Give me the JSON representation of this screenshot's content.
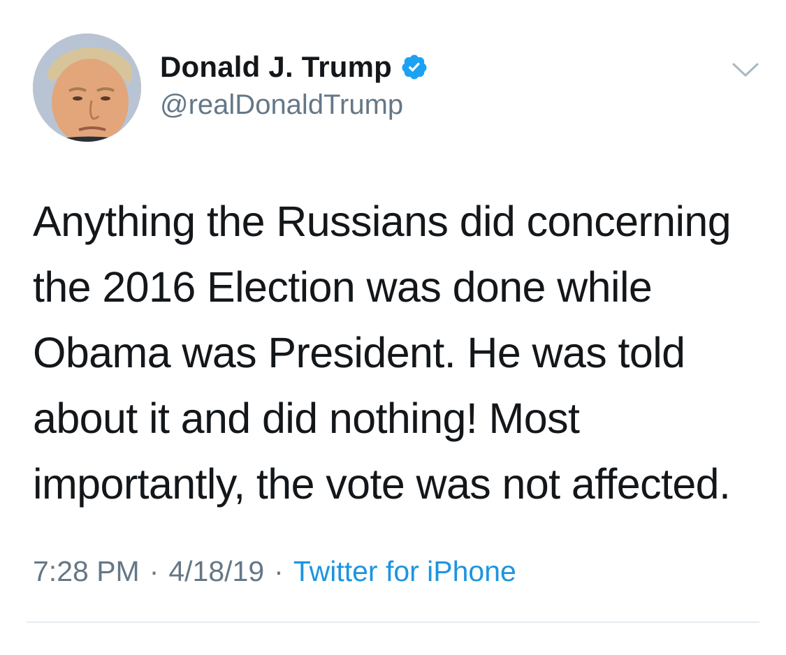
{
  "author": {
    "display_name": "Donald J. Trump",
    "handle": "@realDonaldTrump",
    "verified": true
  },
  "tweet": {
    "text": "Anything the Russians did concerning\nthe 2016 Election was done while\nObama was President. He was told\nabout it and did nothing! Most\nimportantly, the vote was not affected.",
    "time": "7:28 PM",
    "date": "4/18/19",
    "separator": "·",
    "source": "Twitter for iPhone"
  },
  "icons": {
    "verified": "verified-badge-icon",
    "menu": "chevron-down-icon"
  },
  "colors": {
    "text": "#14171a",
    "secondary": "#657786",
    "link": "#1b95e0",
    "verified": "#1da1f2",
    "divider": "#e6ecf0"
  }
}
